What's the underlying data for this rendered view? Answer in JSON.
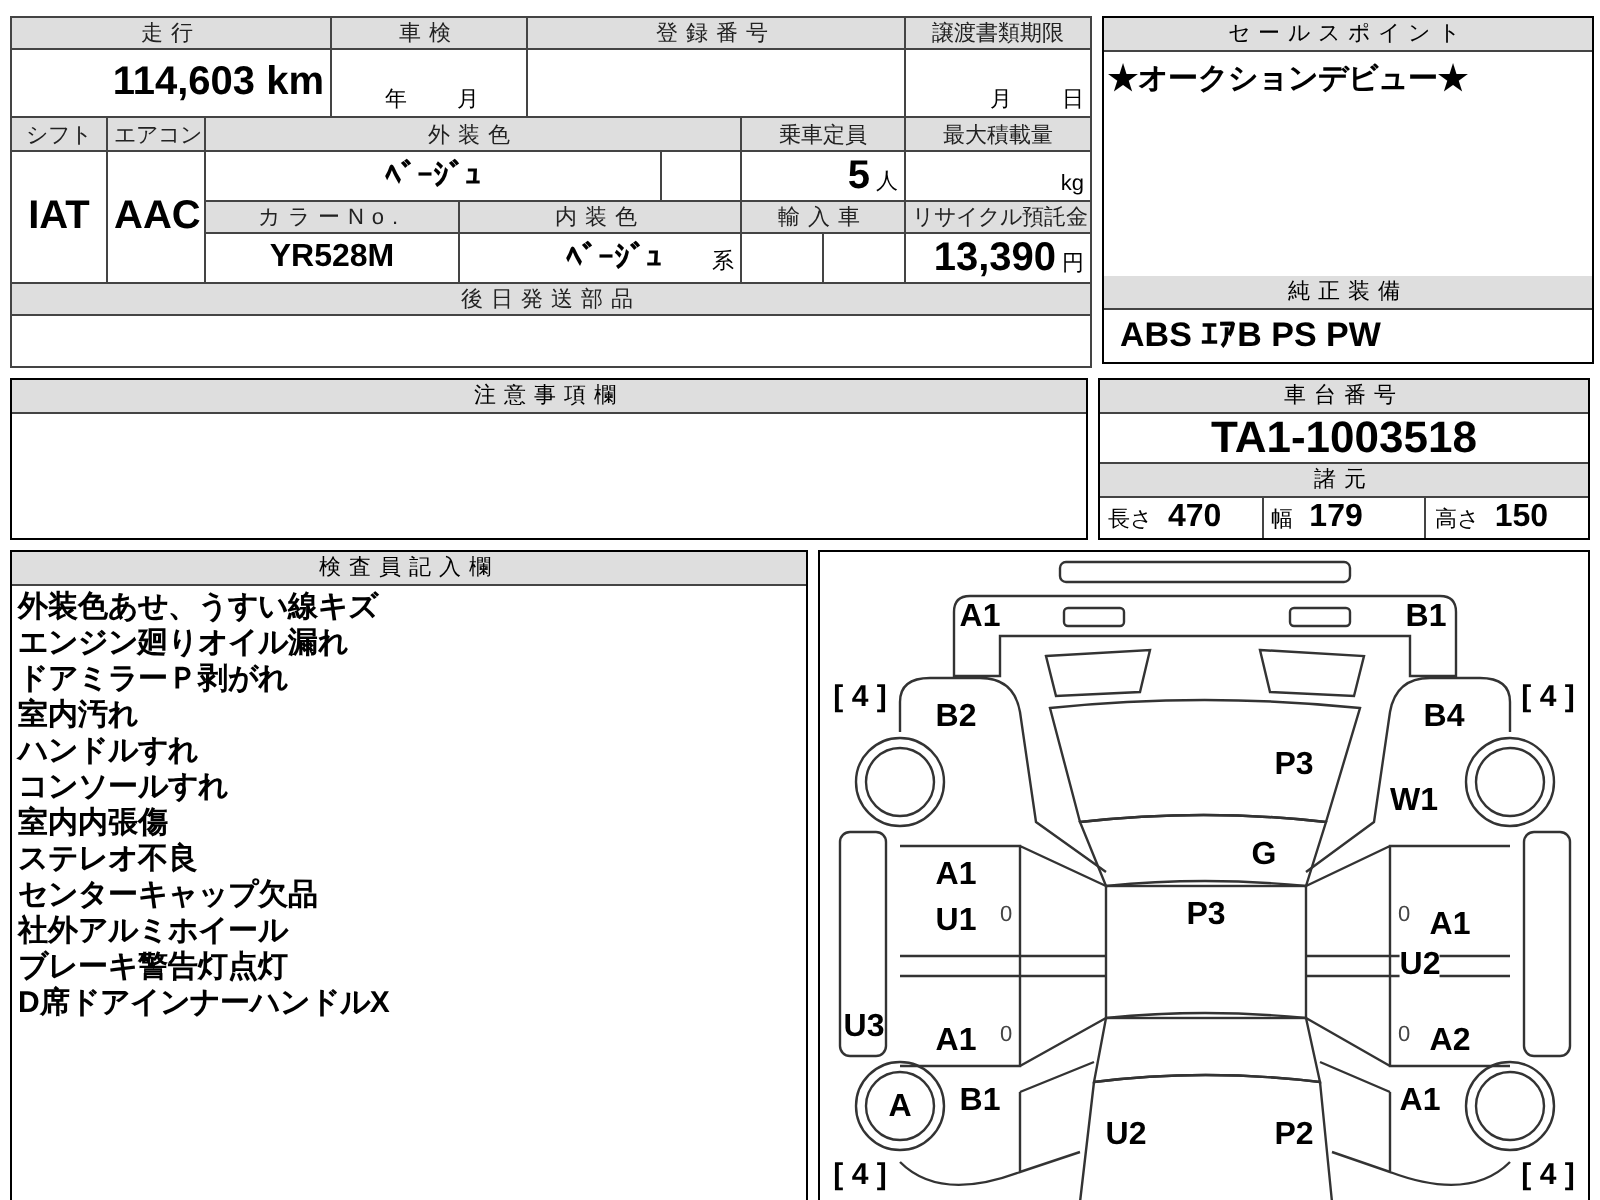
{
  "vehicle_table": {
    "mileage": {
      "label": "走行",
      "value": "114,603",
      "unit": "km"
    },
    "inspection": {
      "label": "車検",
      "year_unit": "年",
      "month_unit": "月"
    },
    "registration_number": {
      "label": "登録番号"
    },
    "transfer_deadline": {
      "label": "譲渡書類期限",
      "month_unit": "月",
      "day_unit": "日"
    },
    "shift": {
      "label": "シフト",
      "value": "IAT"
    },
    "aircon": {
      "label": "エアコン",
      "value": "AAC"
    },
    "exterior_color": {
      "label": "外装色",
      "value": "ﾍﾞｰｼﾞｭ"
    },
    "capacity": {
      "label": "乗車定員",
      "value": "5",
      "unit": "人"
    },
    "max_load": {
      "label": "最大積載量",
      "unit": "kg"
    },
    "color_no": {
      "label": "カラーNo.",
      "value": "YR528M"
    },
    "interior_color": {
      "label": "内装色",
      "value": "ﾍﾞｰｼﾞｭ",
      "unit": "系"
    },
    "imported": {
      "label": "輸入車"
    },
    "recycle_fee": {
      "label": "リサイクル預託金",
      "value": "13,390",
      "unit": "円"
    },
    "later_parts": {
      "label": "後日発送部品"
    }
  },
  "sale_points": {
    "label": "セールスポイント",
    "text": "★オークションデビュー★"
  },
  "equipment": {
    "label": "純正装備",
    "value": "ABS ｴｱB PS PW"
  },
  "caution": {
    "label": "注意事項欄"
  },
  "chassis": {
    "label": "車台番号",
    "value": "TA1-1003518",
    "specs_label": "諸元",
    "specs": [
      {
        "label": "長さ",
        "value": "470"
      },
      {
        "label": "幅",
        "value": "179"
      },
      {
        "label": "高さ",
        "value": "150"
      }
    ]
  },
  "inspector": {
    "label": "検査員記入欄",
    "notes": [
      "外装色あせ、うすい線キズ",
      "エンジン廻りオイル漏れ",
      "ドアミラーＰ剥がれ",
      "室内汚れ",
      "ハンドルすれ",
      "コンソールすれ",
      "室内内張傷",
      "ステレオ不良",
      "センターキャップ欠品",
      "社外アルミホイール",
      "ブレーキ警告灯点灯",
      "D席ドアインナーハンドルX"
    ]
  },
  "diagram": {
    "codes": [
      "A1",
      "B1",
      "B2",
      "B4",
      "P3",
      "W1",
      "G",
      "A1",
      "U1",
      "P3",
      "A1",
      "U2",
      "U3",
      "A1",
      "A2",
      "A",
      "B1",
      "A1",
      "U2",
      "P2"
    ],
    "small_marks": [
      "0",
      "0",
      "0",
      "0"
    ],
    "tread_depths": [
      "[ 4 ]",
      "[ 4 ]",
      "[ 4 ]",
      "[ 4 ]"
    ]
  }
}
